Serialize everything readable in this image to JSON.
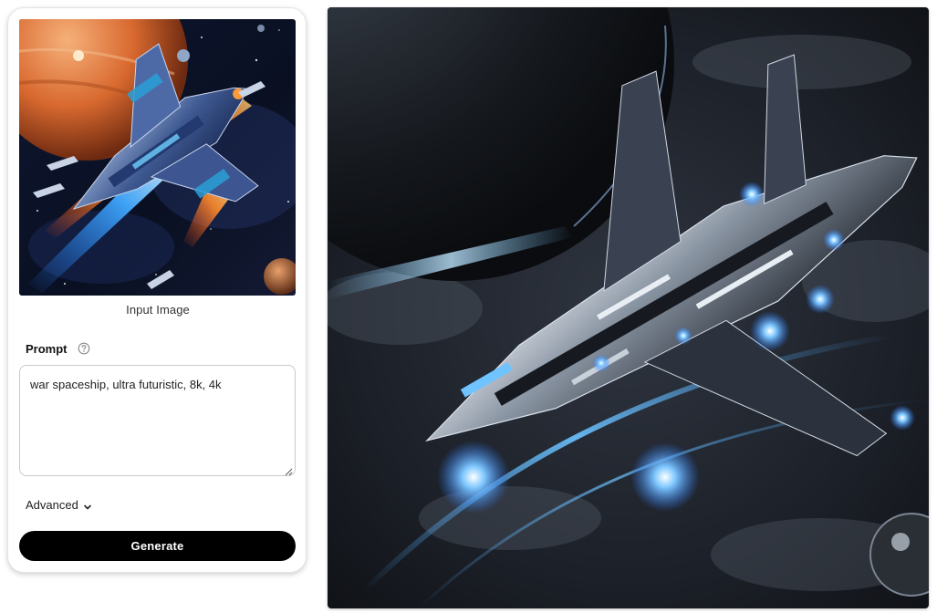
{
  "input_panel": {
    "image_caption": "Input Image",
    "image_description_icon": "spaceship-artwork",
    "prompt_label": "Prompt",
    "prompt_help_icon": "help-circle-icon",
    "prompt_value": "war spaceship, ultra futuristic, 8k, 4k",
    "advanced_label": "Advanced",
    "advanced_icon": "chevron-down-icon",
    "generate_label": "Generate"
  },
  "output_panel": {
    "image_icon": "generated-spaceship-artwork"
  },
  "colors": {
    "button_bg": "#000000",
    "button_text": "#ffffff",
    "card_border": "#e3e3e3",
    "glow_blue": "#4aa8ff"
  }
}
